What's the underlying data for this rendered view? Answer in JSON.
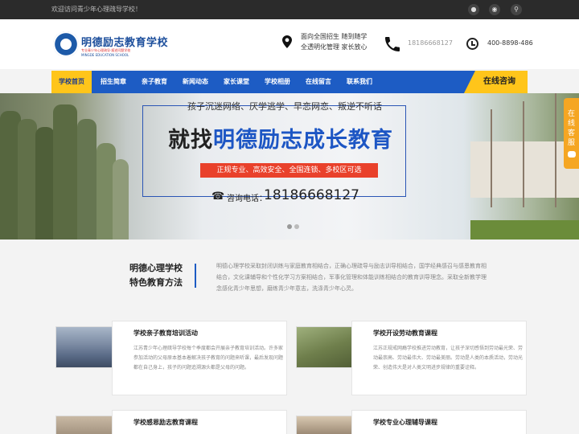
{
  "topbar": {
    "welcome": "欢迎访问青少年心理疏导学校！",
    "icons": [
      "qq-icon",
      "wechat-icon",
      "search-icon"
    ]
  },
  "header": {
    "logo_title": "明德励志教育学校",
    "logo_sub": "专业青少年心理疏导·叛逆问题学校",
    "logo_sub2": "MINGDE EDUCATION SCHOOL",
    "slogan_line1": "面向全国招生 随到随学",
    "slogan_line2": "全透明化管理 家长放心",
    "phone": "18186668127",
    "hotline": "400-8898-486"
  },
  "nav": {
    "items": [
      {
        "label": "学校首页",
        "active": true
      },
      {
        "label": "招生简章",
        "active": false
      },
      {
        "label": "亲子教育",
        "active": false
      },
      {
        "label": "新闻动态",
        "active": false
      },
      {
        "label": "家长课堂",
        "active": false
      },
      {
        "label": "学校相册",
        "active": false
      },
      {
        "label": "在线留言",
        "active": false
      },
      {
        "label": "联系我们",
        "active": false
      }
    ],
    "consult": "在线咨询"
  },
  "banner": {
    "subtitle": "孩子沉迷网络、厌学逃学、早恋网恋、叛逆不听话",
    "title_prefix": "就找",
    "title_highlight": "明德励志成长教育",
    "tagline": "正规专业、高效安全、全国连锁、多校区可选",
    "phone_label": "咨询电话：",
    "phone": "18186668127"
  },
  "side_float": {
    "label": "在线客服"
  },
  "intro": {
    "title_line1": "明德心理学校",
    "title_line2": "特色教育方法",
    "text": "明德心理学校采取封闭训练与家庭教育相结合，正确心理疏导与励志训导相结合，国学经典感召与感恩教育相结合，文化课辅导和个性化学习方案相结合，军事化管理和体能训练相结合的教育训导理念。采取全新教学理念感化青少年思想，磨练青少年意志，洗涤青少年心灵。"
  },
  "cards": [
    {
      "title": "学校亲子教育培训活动",
      "text": "江苏青少年心理疏导学校每个季度都会开展亲子教育培训活动。许多家参加活动的父母原本基本着解决孩子教育的问题来听课，最后发现问题都在自己身上，孩子的问题追溯源头都是父母的问题。"
    },
    {
      "title": "学校开设劳动教育课程",
      "text": "江苏正规戒网瘾学校推进劳动教育，让孩子深切感悟到劳动最光荣、劳动最崇高、劳动最伟大、劳动最美丽。劳动是人类的本质活动，劳动光荣、创造伟大是对人类文明进步规律的重要诠释。"
    },
    {
      "title": "学校感恩励志教育课程",
      "text": ""
    },
    {
      "title": "学校专业心理辅导课程",
      "text": ""
    }
  ]
}
